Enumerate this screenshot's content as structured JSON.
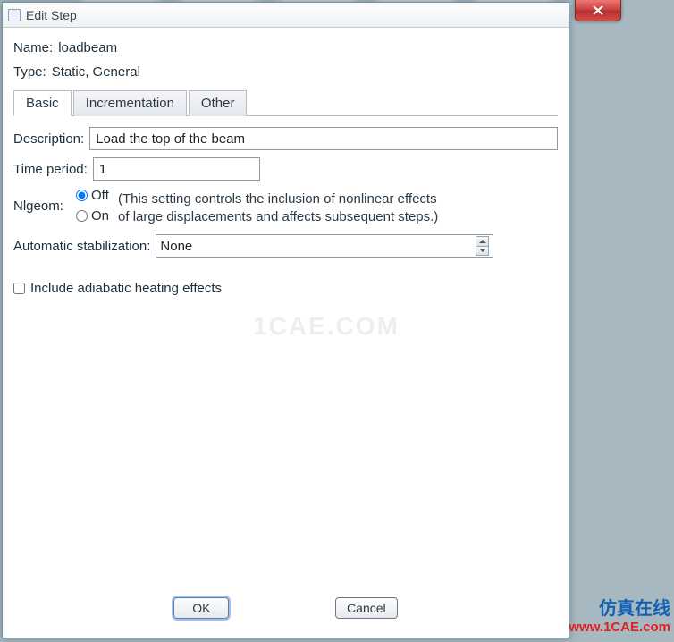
{
  "window": {
    "title": "Edit Step"
  },
  "name": {
    "label": "Name:",
    "value": "loadbeam"
  },
  "type": {
    "label": "Type:",
    "value": "Static, General"
  },
  "tabs": {
    "basic": "Basic",
    "incrementation": "Incrementation",
    "other": "Other"
  },
  "basic": {
    "description_label": "Description:",
    "description_value": "Load the top of the beam",
    "time_period_label": "Time period:",
    "time_period_value": "1",
    "nlgeom_label": "Nlgeom:",
    "nlgeom_off": "Off",
    "nlgeom_on": "On",
    "nlgeom_note_line1": "(This setting controls the inclusion of nonlinear effects",
    "nlgeom_note_line2": "of large displacements and affects subsequent steps.)",
    "stabilization_label": "Automatic stabilization:",
    "stabilization_value": "None",
    "adiabatic_label": "Include adiabatic heating effects"
  },
  "buttons": {
    "ok": "OK",
    "cancel": "Cancel"
  },
  "watermarks": {
    "center": "1CAE.COM",
    "cn": "仿真在线",
    "url": "www.1CAE.com"
  }
}
